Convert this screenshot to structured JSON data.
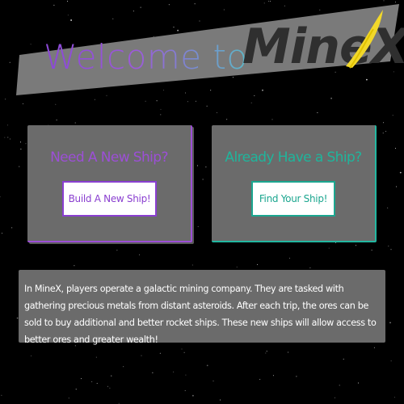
{
  "header": {
    "welcome_text": "Welcome to",
    "logo_text": "MineX"
  },
  "cards": {
    "new_ship": {
      "title": "Need A New Ship?",
      "button_label": "Build A New Ship!"
    },
    "existing_ship": {
      "title": "Already Have a Ship?",
      "button_label": "Find Your Ship!"
    }
  },
  "description": {
    "text": "In MineX, players operate a galactic mining company. They are tasked with gathering precious metals from distant asteroids. After each trip, the ores can be sold to buy additional and better rocket ships. These new ships will allow access to better ores and greater wealth!"
  },
  "colors": {
    "background": "#000000",
    "panel": "#6b6b6b",
    "banner": "#7a7a7a",
    "purple_accent": "#9c4fd6",
    "teal_accent": "#1fb59c",
    "logo_yellow": "#f2d82a"
  }
}
